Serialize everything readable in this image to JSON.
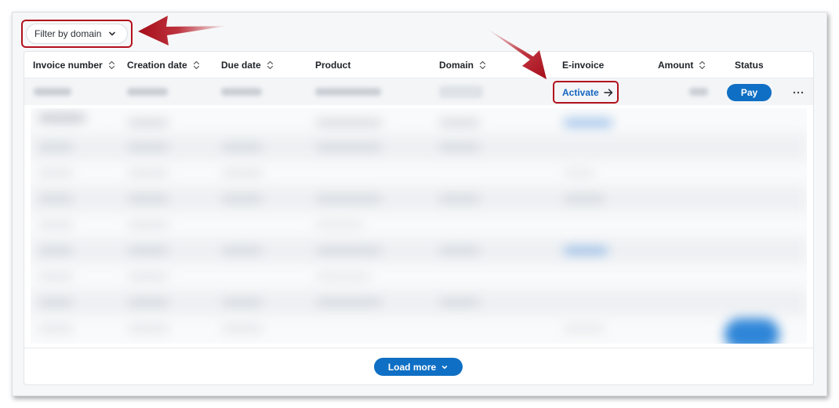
{
  "filter": {
    "label": "Filter by domain"
  },
  "table": {
    "columns": [
      {
        "label": "Invoice number",
        "sortable": true
      },
      {
        "label": "Creation date",
        "sortable": true
      },
      {
        "label": "Due date",
        "sortable": true
      },
      {
        "label": "Product",
        "sortable": false
      },
      {
        "label": "Domain",
        "sortable": true
      },
      {
        "label": "E-invoice",
        "sortable": false
      },
      {
        "label": "Amount",
        "sortable": true
      },
      {
        "label": "Status",
        "sortable": false
      }
    ],
    "first_row": {
      "einvoice_action": "Activate",
      "status_action": "Pay"
    }
  },
  "footer": {
    "load_more_label": "Load more"
  },
  "colors": {
    "primary": "#0f6fc4",
    "link": "#1565c0",
    "highlight": "#b3111e"
  },
  "icons": {
    "filter_chevron": "chevron-down-icon",
    "sort": "sort-updown-icon",
    "activate_arrow": "arrow-right-icon",
    "more": "more-horizontal-icon",
    "load_more_chevron": "chevron-down-icon"
  }
}
